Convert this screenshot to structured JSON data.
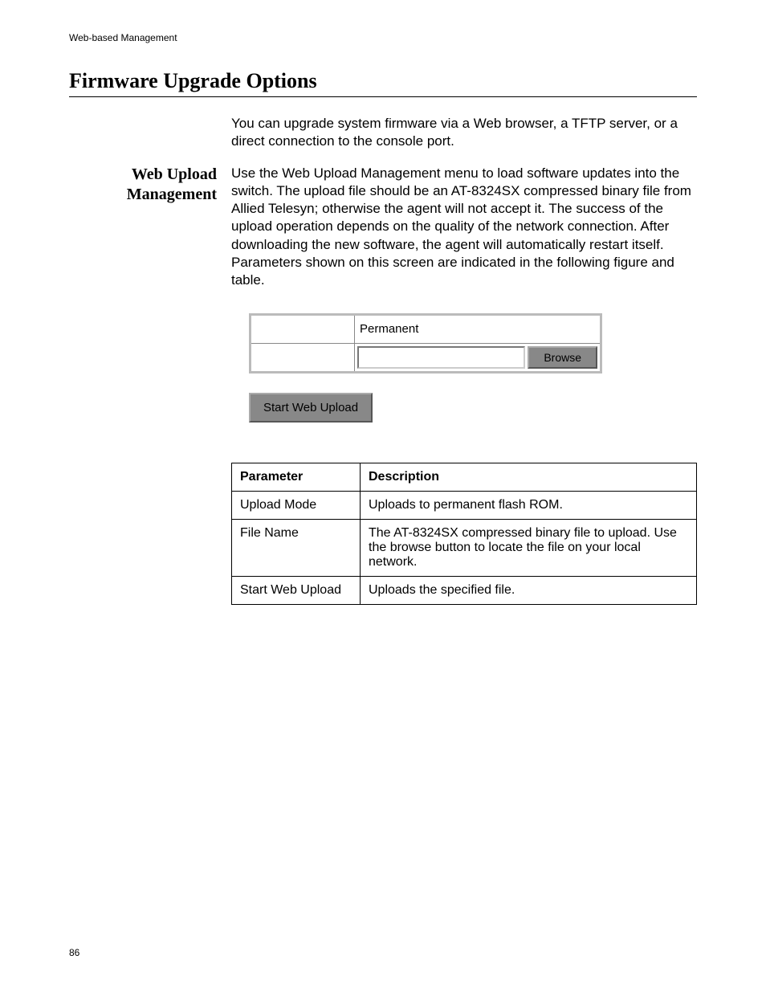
{
  "header": {
    "chapter": "Web-based Management"
  },
  "section": {
    "title": "Firmware Upgrade Options",
    "intro": "You can upgrade system firmware via a Web browser, a TFTP server, or a direct connection to the console port."
  },
  "subsection": {
    "heading_line1": "Web Upload",
    "heading_line2": "Management",
    "body": "Use the Web Upload Management menu to load software updates into the switch. The upload file should be an AT-8324SX compressed binary file from Allied Telesyn; otherwise the agent will not accept it. The success of the upload operation depends on the quality of the network connection. After downloading the new software, the agent will automatically restart itself. Parameters shown on this screen are indicated in the following figure and table."
  },
  "ui": {
    "mode_value": "Permanent",
    "browse_label": "Browse",
    "start_label": "Start Web Upload"
  },
  "table": {
    "headers": {
      "param": "Parameter",
      "desc": "Description"
    },
    "rows": [
      {
        "param": "Upload Mode",
        "desc": "Uploads to permanent flash ROM."
      },
      {
        "param": "File Name",
        "desc": "The AT-8324SX compressed binary file to upload. Use the browse button to locate the file on your local network."
      },
      {
        "param": "Start Web Upload",
        "desc": "Uploads the specified file."
      }
    ]
  },
  "page_number": "86"
}
